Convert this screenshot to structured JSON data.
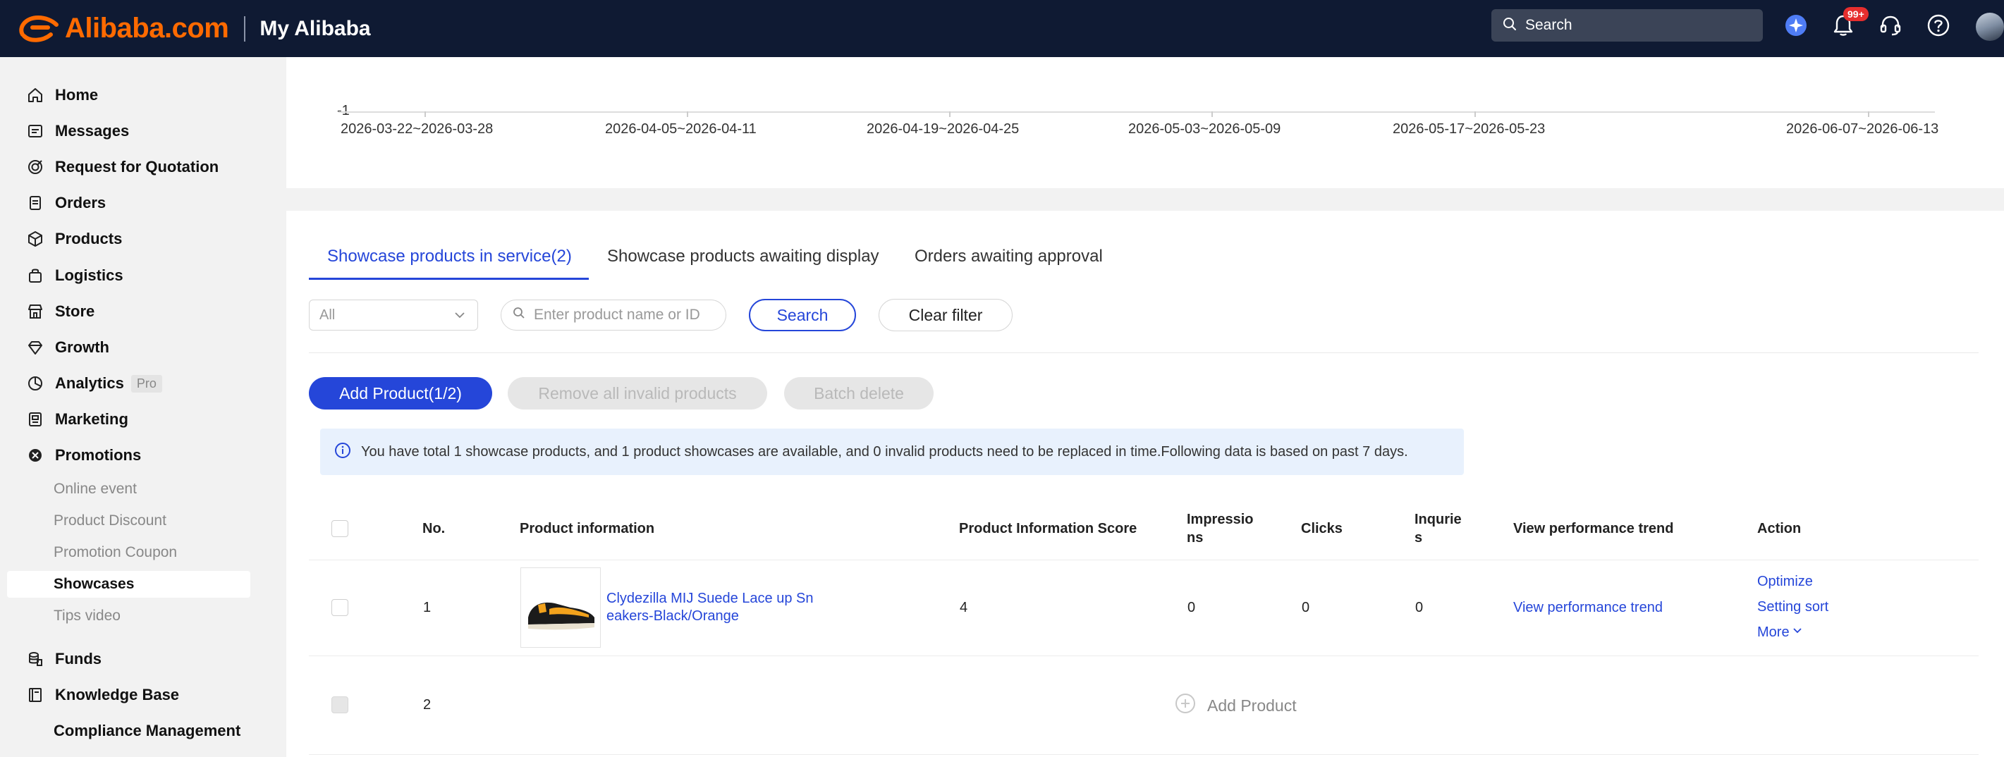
{
  "header": {
    "logo_text": "Alibaba.com",
    "section_title": "My Alibaba",
    "search_label": "Search",
    "notification_badge": "99+"
  },
  "sidebar": {
    "items": [
      {
        "label": "Home",
        "icon": "home-icon"
      },
      {
        "label": "Messages",
        "icon": "messages-icon"
      },
      {
        "label": "Request for Quotation",
        "icon": "rfq-icon"
      },
      {
        "label": "Orders",
        "icon": "orders-icon"
      },
      {
        "label": "Products",
        "icon": "products-icon"
      },
      {
        "label": "Logistics",
        "icon": "logistics-icon"
      },
      {
        "label": "Store",
        "icon": "store-icon"
      },
      {
        "label": "Growth",
        "icon": "growth-icon"
      },
      {
        "label": "Analytics",
        "icon": "analytics-icon",
        "tag": "Pro"
      },
      {
        "label": "Marketing",
        "icon": "marketing-icon"
      },
      {
        "label": "Promotions",
        "icon": "promotions-icon"
      }
    ],
    "promotions_sub": [
      {
        "label": "Online event"
      },
      {
        "label": "Product Discount"
      },
      {
        "label": "Promotion Coupon"
      },
      {
        "label": "Showcases",
        "active": true
      },
      {
        "label": "Tips video"
      }
    ],
    "bottom_items": [
      {
        "label": "Funds",
        "icon": "funds-icon"
      },
      {
        "label": "Knowledge Base",
        "icon": "knowledge-base-icon"
      },
      {
        "label": "Compliance Management"
      }
    ]
  },
  "chart_data": {
    "type": "line",
    "y_tick_label": "-1",
    "x_tick_labels": [
      "2026-03-22~2026-03-28",
      "2026-04-05~2026-04-11",
      "2026-04-19~2026-04-25",
      "2026-05-03~2026-05-09",
      "2026-05-17~2026-05-23",
      "2026-06-07~2026-06-13"
    ]
  },
  "tabs": [
    {
      "label": "Showcase products in service(2)",
      "active": true
    },
    {
      "label": "Showcase products awaiting display"
    },
    {
      "label": "Orders awaiting approval"
    }
  ],
  "filters": {
    "select_value": "All",
    "search_placeholder": "Enter product name or ID",
    "search_button": "Search",
    "clear_button": "Clear filter"
  },
  "actions": {
    "add_product": "Add Product(1/2)",
    "remove_invalid": "Remove all invalid products",
    "batch_delete": "Batch delete"
  },
  "info_message": "You have total 1 showcase products, and 1 product showcases are available, and 0 invalid products need to be replaced in time.Following data is based on past 7 days.",
  "table": {
    "headers": {
      "no": "No.",
      "product_info": "Product information",
      "score": "Product Information Score",
      "impressions_1": "Impressio",
      "impressions_2": "ns",
      "clicks": "Clicks",
      "inquiries_1": "Inqurie",
      "inquiries_2": "s",
      "trend": "View performance trend",
      "action": "Action"
    },
    "rows": [
      {
        "no": "1",
        "product_name_1": "Clydezilla MIJ Suede Lace up Sn",
        "product_name_2": "eakers-Black/Orange",
        "score": "4",
        "impressions": "0",
        "clicks": "0",
        "inquiries": "0",
        "trend_link": "View performance trend",
        "action_optimize": "Optimize",
        "action_sort": "Setting sort",
        "action_more": "More"
      },
      {
        "no": "2",
        "add_product": "Add Product"
      }
    ]
  }
}
